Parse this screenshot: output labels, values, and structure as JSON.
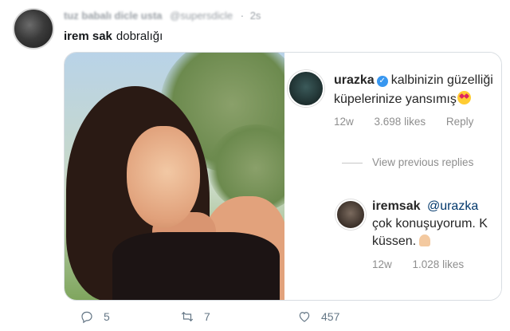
{
  "tweet": {
    "author_name": "tuz babalı dicle usta",
    "author_handle": "@supersdicle",
    "dot": "·",
    "time": "2s",
    "mention": "irem sak",
    "text": "dobralığı"
  },
  "comment1": {
    "user": "urazka",
    "verified_mark": "✓",
    "text_line1": "kalbinizin güzelliği",
    "text_line2": "küpelerinize yansımış",
    "age": "12w",
    "likes": "3.698 likes",
    "reply": "Reply"
  },
  "view_previous": "View previous replies",
  "comment2": {
    "user": "iremsak",
    "mention": "@urazka",
    "text_line2": "çok konuşuyorum. K",
    "text_line3": "küssen.",
    "age": "12w",
    "likes": "1.028 likes"
  },
  "actions": {
    "reply_count": "5",
    "retweet_count": "7",
    "like_count": "457"
  },
  "colors": {
    "text": "#14171a",
    "muted": "#657786",
    "verified": "#3897f0",
    "mention": "#00376b"
  }
}
